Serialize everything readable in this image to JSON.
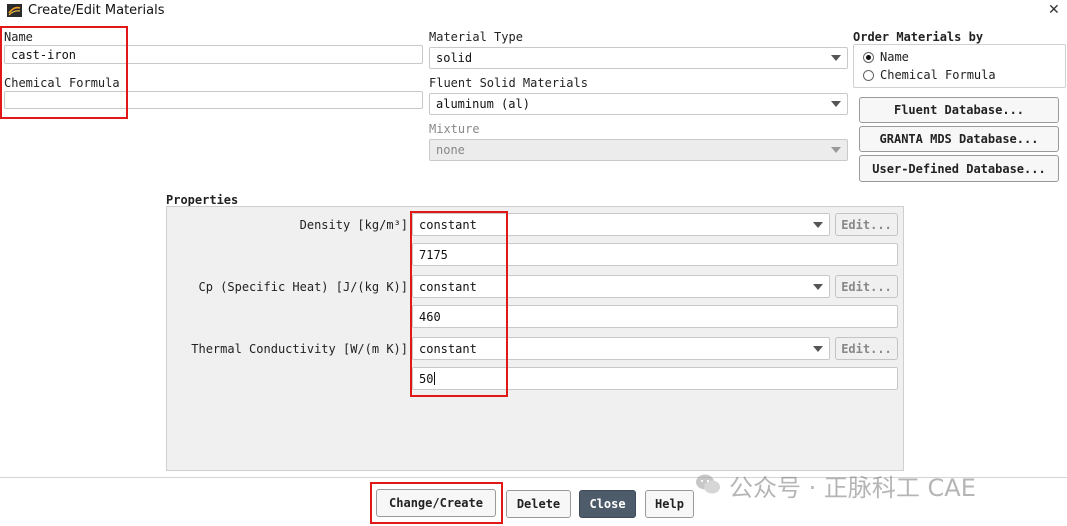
{
  "window": {
    "title": "Create/Edit Materials",
    "close_glyph": "✕",
    "app_icon": "fluent-app-icon"
  },
  "name_field": {
    "label": "Name",
    "value": "cast-iron"
  },
  "formula_field": {
    "label": "Chemical Formula",
    "value": ""
  },
  "material_type": {
    "label": "Material Type",
    "value": "solid"
  },
  "fluent_solid": {
    "label": "Fluent Solid Materials",
    "value": "aluminum (al)"
  },
  "mixture": {
    "label": "Mixture",
    "value": "none"
  },
  "order_by": {
    "label": "Order Materials by",
    "options": [
      "Name",
      "Chemical Formula"
    ],
    "selected": "Name"
  },
  "databases": {
    "fluent": "Fluent Database...",
    "granta": "GRANTA MDS Database...",
    "user": "User-Defined Database..."
  },
  "properties": {
    "title": "Properties",
    "rows": [
      {
        "label": "Density [kg/m³]",
        "method": "constant",
        "value": "7175",
        "edit": "Edit..."
      },
      {
        "label": "Cp (Specific Heat) [J/(kg K)]",
        "method": "constant",
        "value": "460",
        "edit": "Edit..."
      },
      {
        "label": "Thermal Conductivity [W/(m K)]",
        "method": "constant",
        "value": "50",
        "edit": "Edit..."
      }
    ]
  },
  "footer": {
    "change_create": "Change/Create",
    "delete": "Delete",
    "close": "Close",
    "help": "Help"
  },
  "watermark": {
    "text": "公众号 · 正脉科工 CAE"
  },
  "colors": {
    "highlight": "#e01818",
    "primary_button": "#4d5b6b",
    "panel_bg": "#f0f0f0"
  }
}
